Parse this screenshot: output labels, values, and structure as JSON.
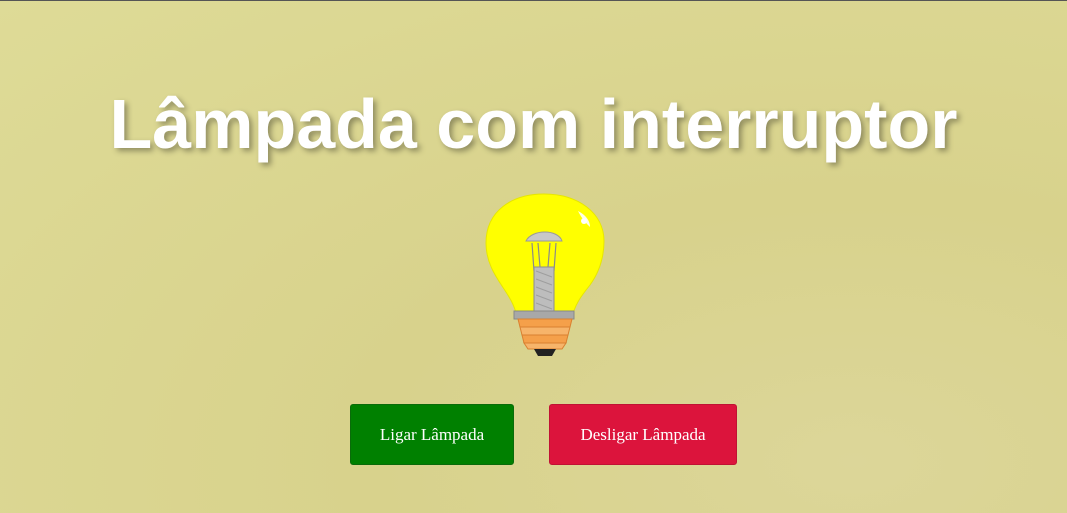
{
  "page": {
    "title": "Lâmpada com interruptor"
  },
  "lamp": {
    "icon": "lightbulb-on-icon",
    "state": "on",
    "glass_color": "#ffff00",
    "base_color": "#f5a04a"
  },
  "buttons": {
    "on_label": "Ligar Lâmpada",
    "off_label": "Desligar Lâmpada",
    "on_color": "#008000",
    "off_color": "#dc143c"
  }
}
